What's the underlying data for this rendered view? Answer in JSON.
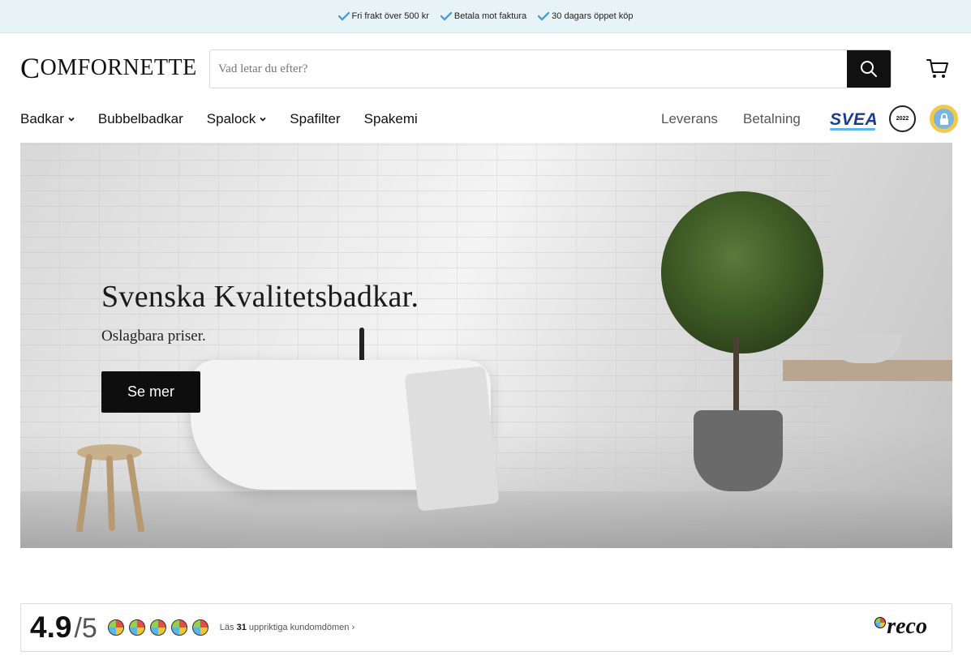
{
  "announcement": {
    "items": [
      "Fri frakt över 500 kr",
      "Betala mot faktura",
      "30 dagars öppet köp"
    ]
  },
  "header": {
    "logo_first": "C",
    "logo_rest": "OMFORNETTE",
    "search_placeholder": "Vad letar du efter?"
  },
  "nav": {
    "items": [
      {
        "label": "Badkar",
        "has_dropdown": true
      },
      {
        "label": "Bubbelbadkar",
        "has_dropdown": false
      },
      {
        "label": "Spalock",
        "has_dropdown": true
      },
      {
        "label": "Spafilter",
        "has_dropdown": false
      },
      {
        "label": "Spakemi",
        "has_dropdown": false
      }
    ],
    "right_links": [
      "Leverans",
      "Betalning"
    ],
    "partner_svea": "SVEA",
    "badge_year": "2022"
  },
  "hero": {
    "title": "Svenska Kvalitetsbadkar.",
    "subtitle": "Oslagbara priser.",
    "button": "Se mer"
  },
  "reco": {
    "score": "4.9",
    "out_of": "/5",
    "reviews_prefix": "Läs ",
    "reviews_count": "31",
    "reviews_suffix": " uppriktiga kundomdömen ›",
    "logo": "reco"
  },
  "colors": {
    "accent_check": "#4a9fd6",
    "topbar_bg": "#e7f3f7",
    "button_bg": "#0e0e0e",
    "svea_blue": "#1a3d8f"
  },
  "icons": [
    "check-icon",
    "search-icon",
    "cart-icon",
    "chevron-down-icon"
  ]
}
